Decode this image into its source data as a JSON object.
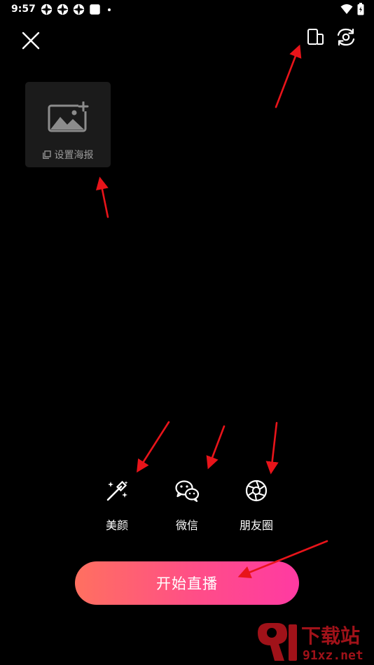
{
  "status_bar": {
    "time": "9:57"
  },
  "poster": {
    "label": "设置海报"
  },
  "tools": {
    "beauty_label": "美颜",
    "wechat_label": "微信",
    "moments_label": "朋友圈"
  },
  "start_button": {
    "label": "开始直播"
  },
  "watermark": {
    "text_cn": "下载站",
    "text_url": "91xz.net"
  },
  "colors": {
    "background": "#000000",
    "poster_card": "#1b1b1b",
    "start_gradient_left": "#ff7060",
    "start_gradient_right": "#ff3aa2",
    "annotation_arrow": "#e8141a"
  },
  "icons": {
    "close": "close-icon",
    "orientation": "screen-orientation-icon",
    "camera_flip": "camera-flip-icon",
    "poster_image": "add-image-icon",
    "beauty": "magic-wand-icon",
    "wechat": "wechat-icon",
    "moments": "aperture-icon"
  }
}
